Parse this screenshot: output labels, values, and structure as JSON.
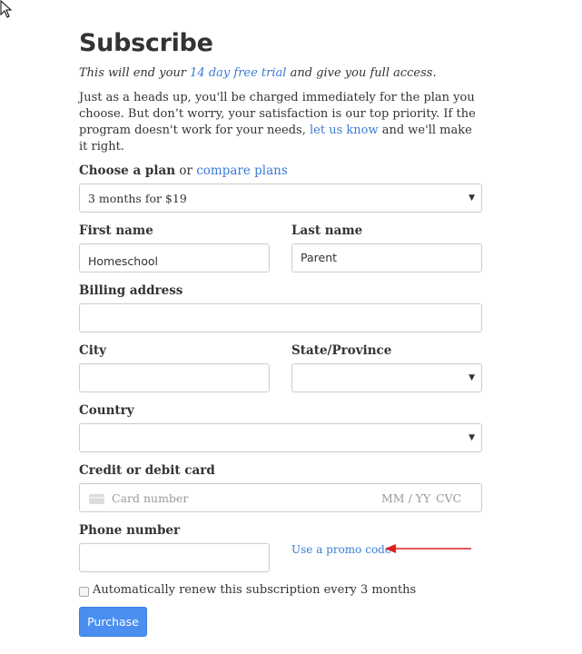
{
  "page": {
    "title": "Subscribe",
    "subtitle_before": "This will end your ",
    "subtitle_link": "14 day free trial",
    "subtitle_after": " and give you full access.",
    "notice_before": "Just as a heads up, you'll be charged immediately for the plan you choose. But don’t worry, your satisfaction is our top priority. If the program doesn't work for your needs, ",
    "notice_link": "let us know",
    "notice_after": " and we'll make it right."
  },
  "plan": {
    "label": "Choose a plan",
    "or_text": " or ",
    "compare_link": "compare plans",
    "selected": "3 months for $19"
  },
  "first_name": {
    "label": "First name",
    "value": "Homeschool"
  },
  "last_name": {
    "label": "Last name",
    "value": "Parent"
  },
  "billing_address": {
    "label": "Billing address",
    "value": ""
  },
  "city": {
    "label": "City",
    "value": ""
  },
  "state": {
    "label": "State/Province",
    "selected": ""
  },
  "country": {
    "label": "Country",
    "selected": ""
  },
  "card": {
    "label": "Credit or debit card",
    "icon": "credit-card-icon",
    "number_placeholder": "Card number",
    "expiry_placeholder": "MM / YY",
    "cvc_placeholder": "CVC"
  },
  "phone": {
    "label": "Phone number",
    "value": ""
  },
  "promo": {
    "link": "Use a promo code"
  },
  "auto_renew": {
    "label": "Automatically renew this subscription every 3 months",
    "checked": false
  },
  "purchase": {
    "label": "Purchase"
  },
  "colors": {
    "link": "#3a7bd5",
    "button": "#4a8ff0",
    "annotation_arrow": "#e02020"
  }
}
